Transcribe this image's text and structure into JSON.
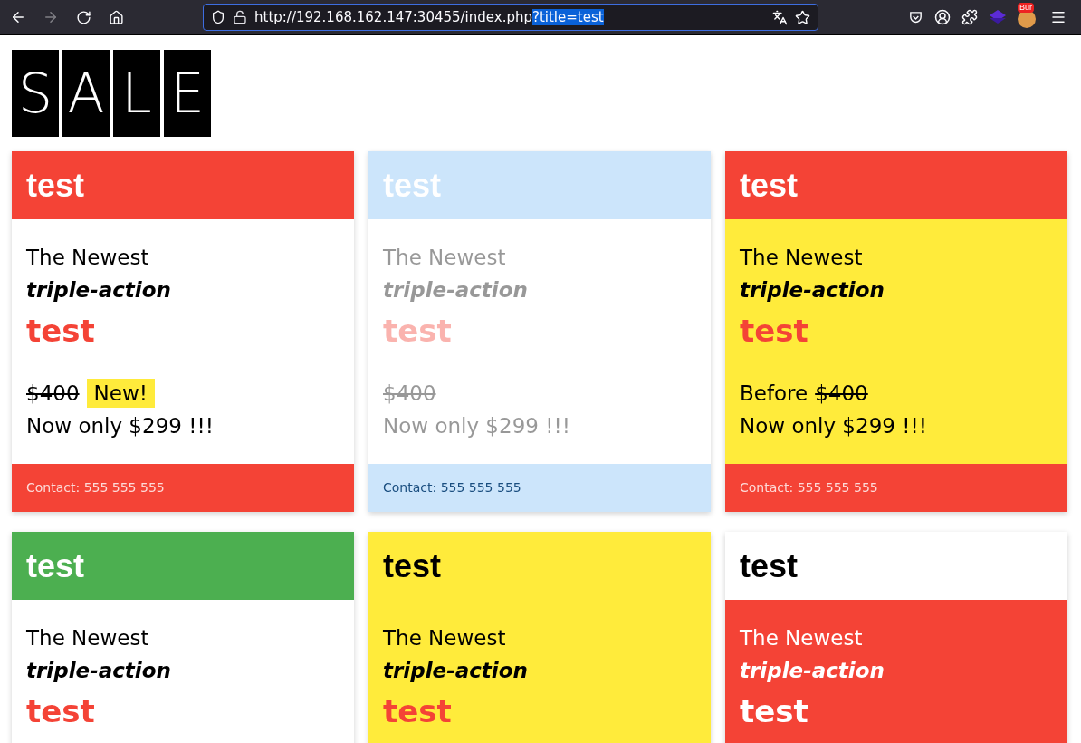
{
  "browser": {
    "forward_disabled": true,
    "url": "http://192.168.162.147:30455/index.php",
    "url_selected": "?title=test",
    "extension_badge": "Bur"
  },
  "logo": {
    "letters": [
      "S",
      "A",
      "L",
      "E"
    ]
  },
  "cards": [
    {
      "faded": false,
      "header": {
        "title": "test",
        "color": "#f44336"
      },
      "body": {
        "color": "#ffffff",
        "lines": [
          "The Newest",
          "triple-action"
        ],
        "accent": "test",
        "price": {
          "old": "$400",
          "badge": "New!",
          "now": "Now only $299 !!!"
        }
      },
      "footer": {
        "contact": "Contact: 555 555 555",
        "color": "#f44336"
      }
    },
    {
      "faded": true,
      "header": {
        "title": "test",
        "color": "#cce5fb"
      },
      "body": {
        "color": "#ffffff",
        "lines": [
          "The Newest",
          "triple-action"
        ],
        "accent": "test",
        "price": {
          "old": "$400",
          "now": "Now only $299 !!!"
        }
      },
      "footer": {
        "contact": "Contact: 555 555 555",
        "color": "#cce5fb"
      }
    },
    {
      "faded": false,
      "header": {
        "title": "test",
        "color": "#f44336"
      },
      "body": {
        "color": "#ffeb3b",
        "lines": [
          "The Newest",
          "triple-action"
        ],
        "accent": "test",
        "price": {
          "prefix": "Before",
          "old": "$400",
          "now": "Now only $299 !!!"
        }
      },
      "footer": {
        "contact": "Contact: 555 555 555",
        "color": "#f44336"
      }
    },
    {
      "faded": false,
      "header": {
        "title": "test",
        "color": "#4caf50"
      },
      "body": {
        "color": "#ffffff",
        "lines": [
          "The Newest",
          "triple-action"
        ],
        "accent": "test"
      }
    },
    {
      "faded": false,
      "header": {
        "title": "test",
        "color": "#ffeb3b"
      },
      "body": {
        "color": "#ffeb3b",
        "lines": [
          "The Newest",
          "triple-action"
        ],
        "accent": "test"
      }
    },
    {
      "faded": false,
      "header": {
        "title": "test",
        "color": "#ffffff"
      },
      "body": {
        "color": "#f44336",
        "lines": [
          "The Newest",
          "triple-action"
        ],
        "accent": "test"
      }
    }
  ]
}
